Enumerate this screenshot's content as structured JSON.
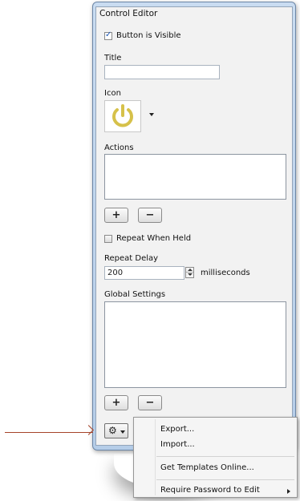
{
  "panel": {
    "title": "Control Editor",
    "visible_checkbox_label": "Button is Visible",
    "title_label": "Title",
    "title_value": "",
    "icon_label": "Icon",
    "actions_label": "Actions",
    "add_label": "+",
    "remove_label": "−",
    "repeat_label": "Repeat When Held",
    "repeat_delay_label": "Repeat Delay",
    "repeat_delay_value": "200",
    "repeat_delay_unit": "milliseconds",
    "global_settings_label": "Global Settings"
  },
  "menu": {
    "items": [
      {
        "label": "Export..."
      },
      {
        "label": "Import..."
      },
      {
        "label": "Get Templates Online..."
      },
      {
        "label": "Require Password to Edit"
      }
    ]
  },
  "colors": {
    "arrow": "#a5432a",
    "power_icon": "#d6c14a"
  },
  "icons": {
    "gear_button": "gear-icon",
    "current_icon": "power-icon"
  }
}
